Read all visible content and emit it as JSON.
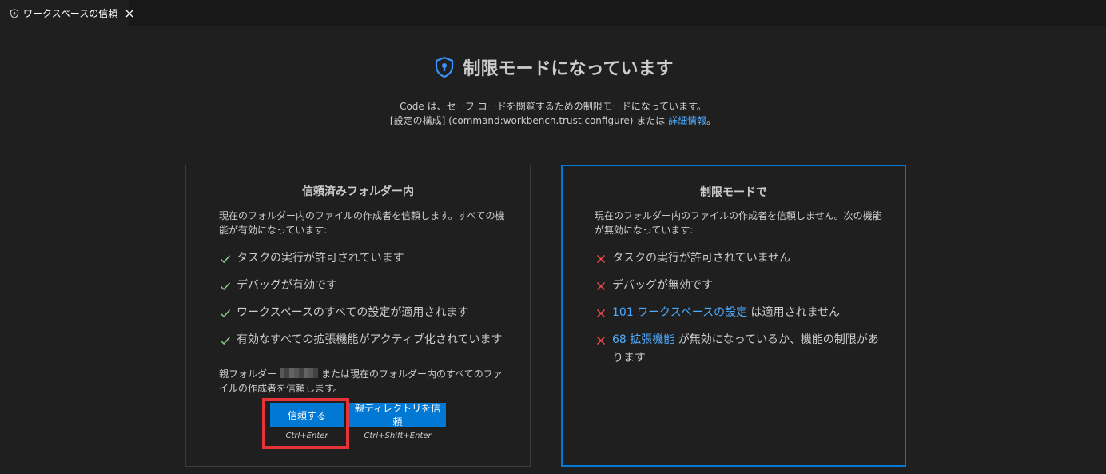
{
  "tab": {
    "label": "ワークスペースの信頼",
    "icon": "shield-icon",
    "close_icon": "close-icon"
  },
  "header": {
    "title": "制限モードになっています",
    "desc_line1": "Code は、セーフ コードを閲覧するための制限モードになっています。",
    "desc_line2_prefix": "[設定の構成] (command:workbench.trust.configure) または ",
    "desc_line2_link": "詳細情報",
    "desc_line2_suffix": "。"
  },
  "trusted": {
    "title": "信頼済みフォルダー内",
    "description": "現在のフォルダー内のファイルの作成者を信頼します。すべての機能が有効になっています:",
    "features": [
      "タスクの実行が許可されています",
      "デバッグが有効です",
      "ワークスペースのすべての設定が適用されます",
      "有効なすべての拡張機能がアクティブ化されています"
    ],
    "parent_note_prefix": "親フォルダー",
    "parent_note_suffix": "または現在のフォルダー内のすべてのファイルの作成者を信頼します。",
    "trust_button": "信頼する",
    "trust_shortcut": "Ctrl+Enter",
    "trust_parent_button": "親ディレクトリを信頼",
    "trust_parent_shortcut": "Ctrl+Shift+Enter"
  },
  "restricted": {
    "title": "制限モードで",
    "description": "現在のフォルダー内のファイルの作成者を信頼しません。次の機能が無効になっています:",
    "features": [
      {
        "text": "タスクの実行が許可されていません"
      },
      {
        "text": "デバッグが無効です"
      },
      {
        "link": "101 ワークスペースの設定",
        "text": " は適用されません"
      },
      {
        "link": "68 拡張機能",
        "text": " が無効になっているか、機能の制限があります"
      }
    ]
  },
  "colors": {
    "accent": "#0078d4",
    "link": "#4daafc",
    "check": "#89d185",
    "cross": "#f14c4c",
    "highlight": "#e6333a"
  }
}
